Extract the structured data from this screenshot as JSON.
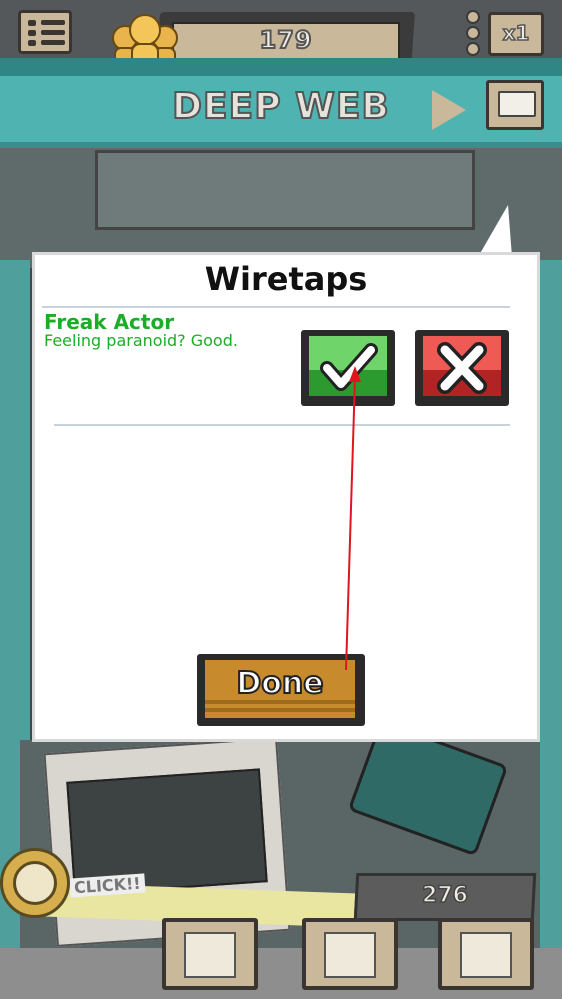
{
  "header": {
    "fans_count": "179",
    "multiplier": "x1"
  },
  "location": {
    "title": "DEEP WEB"
  },
  "popup": {
    "title": "Wiretaps",
    "item": {
      "name": "Freak Actor",
      "description": "Feeling paranoid? Good."
    },
    "done_label": "Done"
  },
  "scene": {
    "click_label": "CLICK!!",
    "score": "276"
  },
  "colors": {
    "teal_bar": "#4fb3b1",
    "item_green": "#1cad28",
    "accept_green": "#2c9a2f",
    "reject_red": "#b22424",
    "done_orange": "#c78a2c",
    "annotation_arrow": "#e0141e"
  },
  "icons": {
    "menu": "list-menu-icon",
    "fans": "fans-group-icon",
    "options": "vertical-dots-icon",
    "play": "play-triangle-icon",
    "chat": "chat-bubble-icon",
    "accept": "checkmark-icon",
    "reject": "x-cross-icon",
    "timer": "clock-icon",
    "nav_upgrade": "eye-up-arrow-icon",
    "nav_fans": "eye-person-icon",
    "nav_shop": "eye-bag-icon"
  }
}
